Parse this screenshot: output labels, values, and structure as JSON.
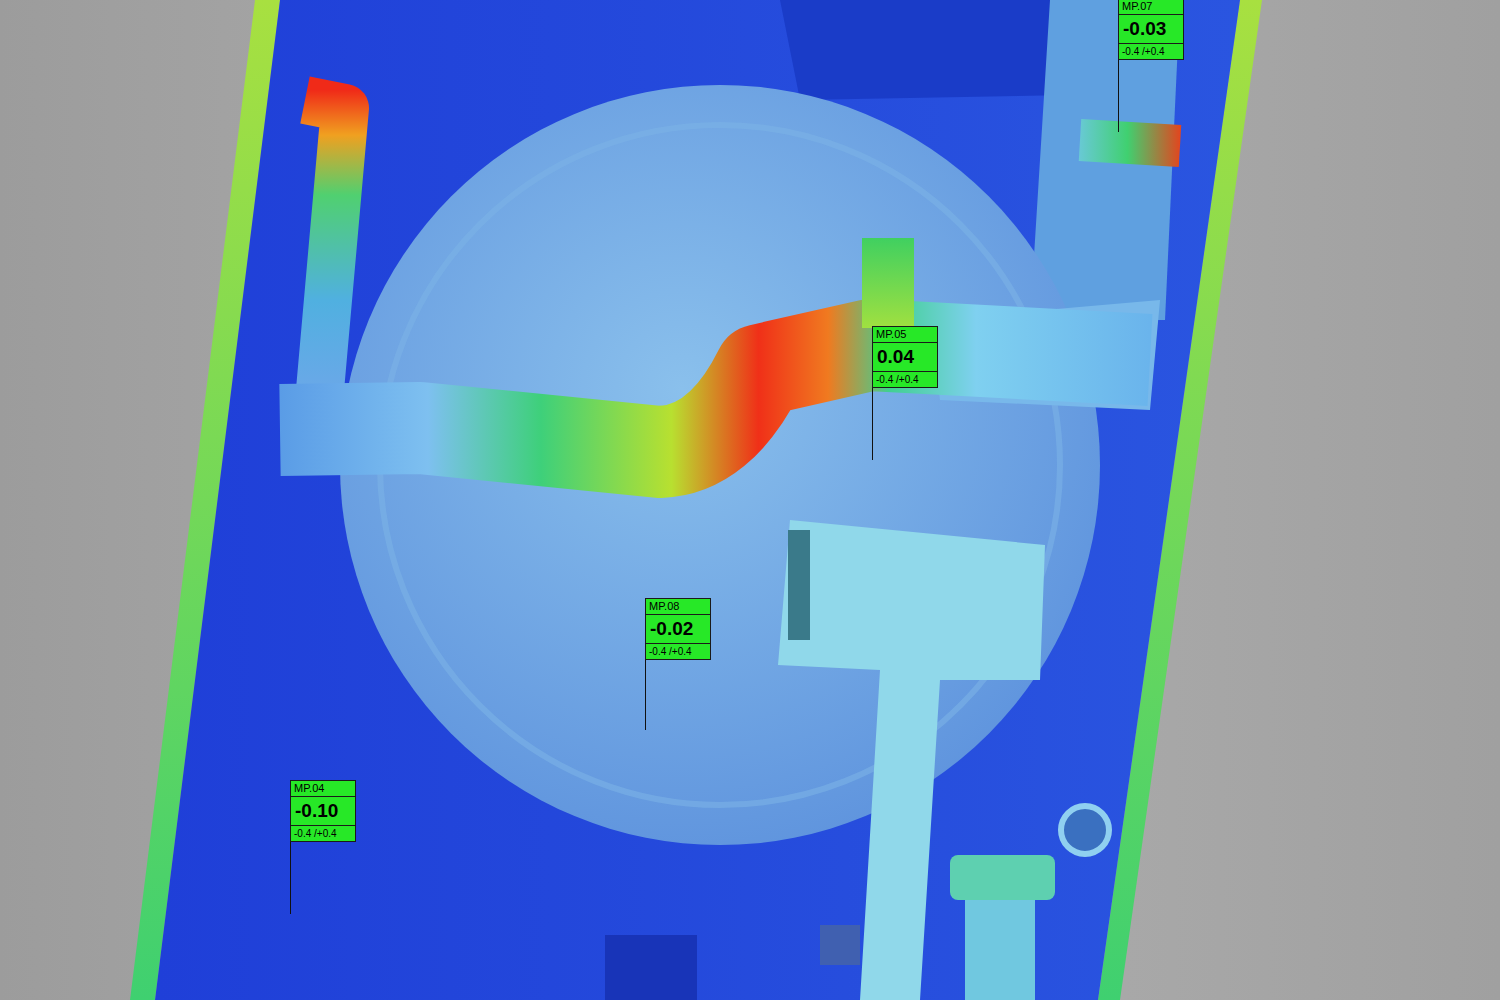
{
  "viewport": {
    "measuring_points": [
      {
        "name": "MP.07",
        "value": "-0.03",
        "tolerance": "-0.4 /+0.4",
        "in_tolerance": true
      },
      {
        "name": "MP.05",
        "value": "0.04",
        "tolerance": "-0.4 /+0.4",
        "in_tolerance": true
      },
      {
        "name": "MP.08",
        "value": "-0.02",
        "tolerance": "-0.4 /+0.4",
        "in_tolerance": true
      },
      {
        "name": "MP.04",
        "value": "-0.10",
        "tolerance": "-0.4 /+0.4",
        "in_tolerance": true
      }
    ]
  }
}
